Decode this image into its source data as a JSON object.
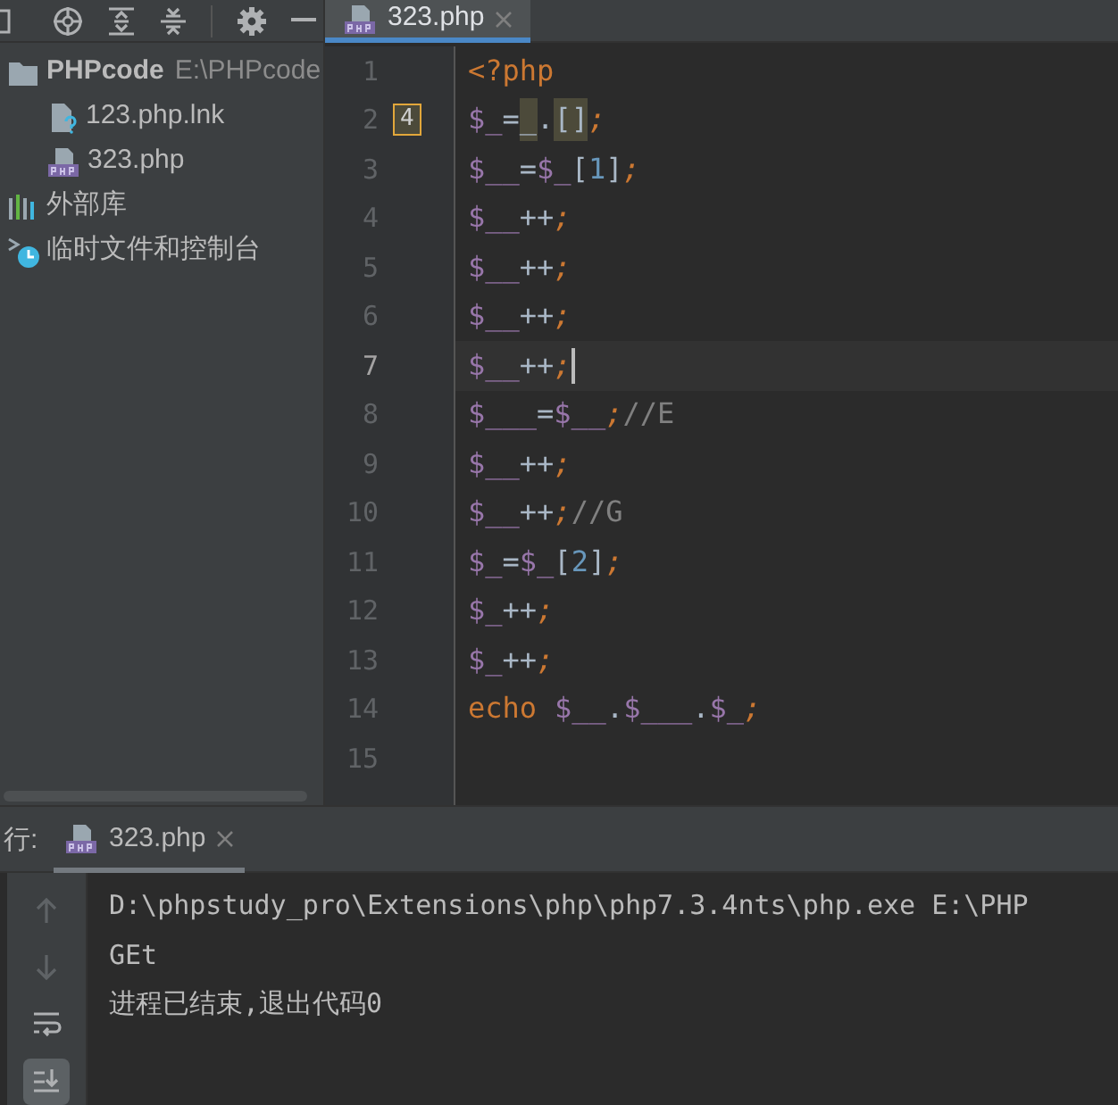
{
  "project_tree": {
    "items": [
      {
        "label": "PHPcode",
        "path": "E:\\PHPcode",
        "kind": "folder",
        "children": [
          {
            "label": "123.php.lnk",
            "kind": "unknown-file"
          },
          {
            "label": "323.php",
            "kind": "php-file"
          }
        ]
      },
      {
        "label": "外部库",
        "kind": "library"
      },
      {
        "label": "临时文件和控制台",
        "kind": "scratches"
      }
    ]
  },
  "editor_tabs": [
    {
      "label": "323.php",
      "selected": true
    }
  ],
  "editor": {
    "lines": [
      {
        "number": "1",
        "tokens": [
          {
            "text": "<?php",
            "kind": "keyword"
          }
        ]
      },
      {
        "number": "2",
        "hint": "4",
        "tokens": [
          {
            "text": "$_",
            "kind": "variable"
          },
          {
            "text": "=",
            "kind": "operator"
          },
          {
            "text": "_",
            "kind": "highlight"
          },
          {
            "text": ".",
            "kind": "operator"
          },
          {
            "text": "[]",
            "kind": "highlight"
          },
          {
            "text": ";",
            "kind": "semicolon"
          }
        ]
      },
      {
        "number": "3",
        "tokens": [
          {
            "text": "$__",
            "kind": "variable"
          },
          {
            "text": "=",
            "kind": "operator"
          },
          {
            "text": "$_",
            "kind": "variable"
          },
          {
            "text": "[",
            "kind": "operator"
          },
          {
            "text": "1",
            "kind": "number"
          },
          {
            "text": "]",
            "kind": "operator"
          },
          {
            "text": ";",
            "kind": "semicolon"
          }
        ]
      },
      {
        "number": "4",
        "tokens": [
          {
            "text": "$__",
            "kind": "variable"
          },
          {
            "text": "++",
            "kind": "operator"
          },
          {
            "text": ";",
            "kind": "semicolon"
          }
        ]
      },
      {
        "number": "5",
        "tokens": [
          {
            "text": "$__",
            "kind": "variable"
          },
          {
            "text": "++",
            "kind": "operator"
          },
          {
            "text": ";",
            "kind": "semicolon"
          }
        ]
      },
      {
        "number": "6",
        "tokens": [
          {
            "text": "$__",
            "kind": "variable"
          },
          {
            "text": "++",
            "kind": "operator"
          },
          {
            "text": ";",
            "kind": "semicolon"
          }
        ]
      },
      {
        "number": "7",
        "current": true,
        "tokens": [
          {
            "text": "$__",
            "kind": "variable"
          },
          {
            "text": "++",
            "kind": "operator"
          },
          {
            "text": ";",
            "kind": "semicolon"
          }
        ]
      },
      {
        "number": "8",
        "tokens": [
          {
            "text": "$___",
            "kind": "variable"
          },
          {
            "text": "=",
            "kind": "operator"
          },
          {
            "text": "$__",
            "kind": "variable"
          },
          {
            "text": ";",
            "kind": "semicolon"
          },
          {
            "text": "//E",
            "kind": "comment"
          }
        ]
      },
      {
        "number": "9",
        "tokens": [
          {
            "text": "$__",
            "kind": "variable"
          },
          {
            "text": "++",
            "kind": "operator"
          },
          {
            "text": ";",
            "kind": "semicolon"
          }
        ]
      },
      {
        "number": "10",
        "tokens": [
          {
            "text": "$__",
            "kind": "variable"
          },
          {
            "text": "++",
            "kind": "operator"
          },
          {
            "text": ";",
            "kind": "semicolon"
          },
          {
            "text": "//G",
            "kind": "comment"
          }
        ]
      },
      {
        "number": "11",
        "tokens": [
          {
            "text": "$_",
            "kind": "variable"
          },
          {
            "text": "=",
            "kind": "operator"
          },
          {
            "text": "$_",
            "kind": "variable"
          },
          {
            "text": "[",
            "kind": "operator"
          },
          {
            "text": "2",
            "kind": "number"
          },
          {
            "text": "]",
            "kind": "operator"
          },
          {
            "text": ";",
            "kind": "semicolon"
          }
        ]
      },
      {
        "number": "12",
        "tokens": [
          {
            "text": "$_",
            "kind": "variable"
          },
          {
            "text": "++",
            "kind": "operator"
          },
          {
            "text": ";",
            "kind": "semicolon"
          }
        ]
      },
      {
        "number": "13",
        "tokens": [
          {
            "text": "$_",
            "kind": "variable"
          },
          {
            "text": "++",
            "kind": "operator"
          },
          {
            "text": ";",
            "kind": "semicolon"
          }
        ]
      },
      {
        "number": "14",
        "tokens": [
          {
            "text": "echo",
            "kind": "keyword"
          },
          {
            "text": "$__",
            "kind": "variable"
          },
          {
            "text": ".",
            "kind": "operator"
          },
          {
            "text": "$___",
            "kind": "variable"
          },
          {
            "text": ".",
            "kind": "operator"
          },
          {
            "text": "$_",
            "kind": "variable"
          },
          {
            "text": ";",
            "kind": "semicolon"
          }
        ]
      },
      {
        "number": "15"
      }
    ]
  },
  "run_panel": {
    "label": "行:",
    "tabs": [
      {
        "label": "323.php",
        "selected": true
      }
    ],
    "toolbar": [
      {
        "kind": "up",
        "disabled": true
      },
      {
        "kind": "down",
        "disabled": true
      },
      {
        "kind": "wrap",
        "selected": false
      },
      {
        "kind": "scroll-end",
        "selected": true
      }
    ],
    "output": [
      "D:\\phpstudy_pro\\Extensions\\php\\php7.3.4nts\\php.exe E:\\PHP",
      "GEt",
      "进程已结束,退出代码0"
    ]
  }
}
